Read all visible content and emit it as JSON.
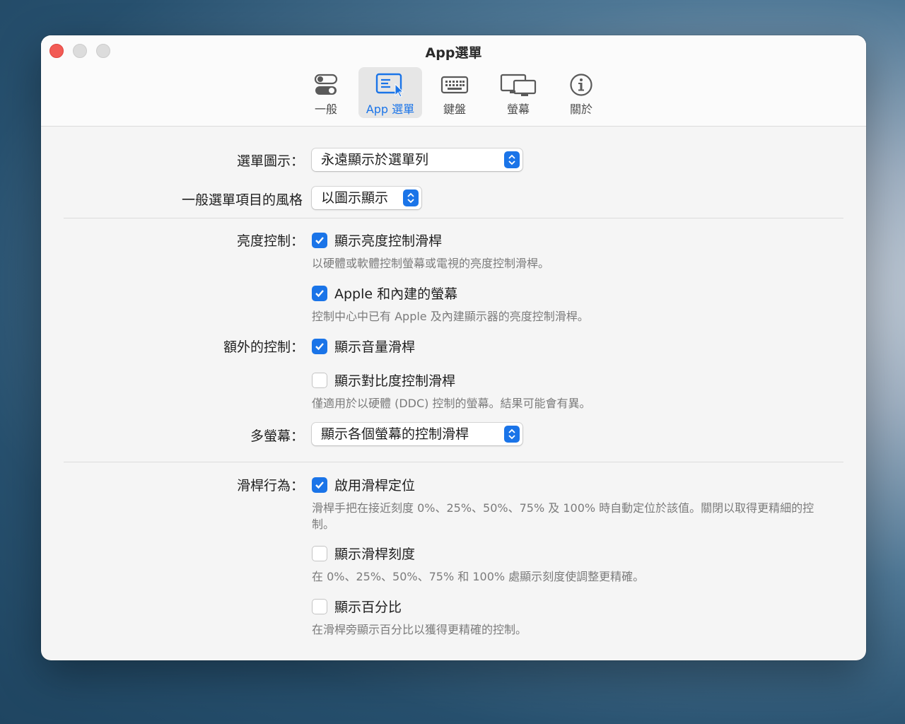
{
  "window": {
    "title": "App選單"
  },
  "tabs": [
    {
      "label": "一般",
      "icon": "toggles-icon",
      "active": false
    },
    {
      "label": "App 選單",
      "icon": "menu-window-icon",
      "active": true
    },
    {
      "label": "鍵盤",
      "icon": "keyboard-icon",
      "active": false
    },
    {
      "label": "螢幕",
      "icon": "displays-icon",
      "active": false
    },
    {
      "label": "關於",
      "icon": "info-icon",
      "active": false
    }
  ],
  "settings": {
    "menu_icon": {
      "label": "選單圖示：",
      "value": "永遠顯示於選單列"
    },
    "menu_style": {
      "label": "一般選單項目的風格",
      "value": "以圖示顯示"
    },
    "brightness": {
      "label": "亮度控制：",
      "show_slider": {
        "label": "顯示亮度控制滑桿",
        "checked": true,
        "desc": "以硬體或軟體控制螢幕或電視的亮度控制滑桿。"
      },
      "apple_builtin": {
        "label": "Apple 和內建的螢幕",
        "checked": true,
        "desc": "控制中心中已有 Apple 及內建顯示器的亮度控制滑桿。"
      }
    },
    "extra": {
      "label": "額外的控制：",
      "volume": {
        "label": "顯示音量滑桿",
        "checked": true
      },
      "contrast": {
        "label": "顯示對比度控制滑桿",
        "checked": false,
        "desc": "僅適用於以硬體 (DDC) 控制的螢幕。結果可能會有異。"
      }
    },
    "multi_display": {
      "label": "多螢幕：",
      "value": "顯示各個螢幕的控制滑桿"
    },
    "slider_behavior": {
      "label": "滑桿行為：",
      "snap": {
        "label": "啟用滑桿定位",
        "checked": true,
        "desc": "滑桿手把在接近刻度 0%、25%、50%、75% 及 100% 時自動定位於該值。關閉以取得更精細的控制。"
      },
      "ticks": {
        "label": "顯示滑桿刻度",
        "checked": false,
        "desc": "在 0%、25%、50%、75% 和 100% 處顯示刻度使調整更精確。"
      },
      "percent": {
        "label": "顯示百分比",
        "checked": false,
        "desc": "在滑桿旁顯示百分比以獲得更精確的控制。"
      }
    }
  },
  "colors": {
    "accent": "#1a74e8",
    "close": "#f25b55"
  }
}
